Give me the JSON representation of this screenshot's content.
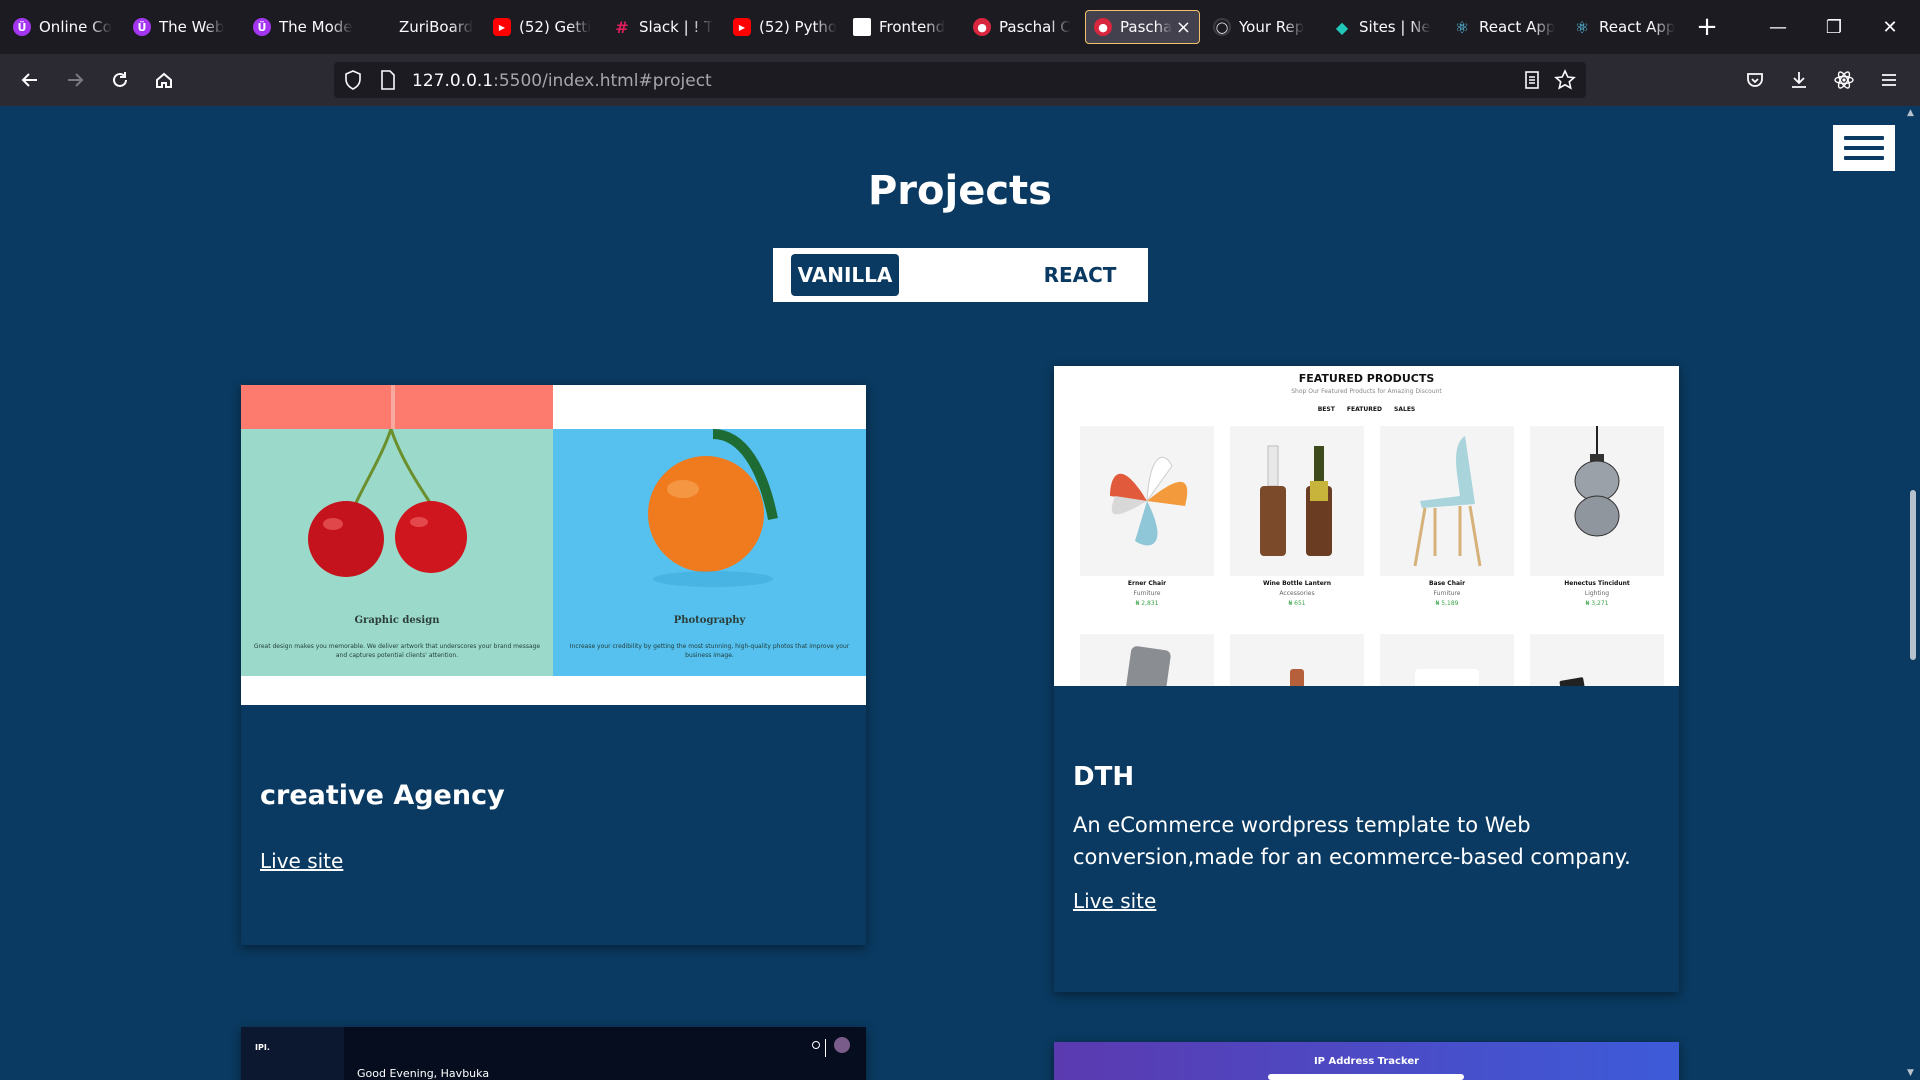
{
  "browser": {
    "tabs": [
      {
        "title": "Online Co",
        "icon": "udemy-icon",
        "color": "#a435f0"
      },
      {
        "title": "The Web",
        "icon": "udemy-icon",
        "color": "#a435f0"
      },
      {
        "title": "The Mode",
        "icon": "udemy-icon",
        "color": "#a435f0"
      },
      {
        "title": "ZuriBoard",
        "icon": "",
        "color": ""
      },
      {
        "title": "(52) Getti",
        "icon": "youtube-icon",
        "color": "#ff0000"
      },
      {
        "title": "Slack | ! T",
        "icon": "slack-icon",
        "color": "#e01e5a"
      },
      {
        "title": "(52) Pytho",
        "icon": "youtube-icon",
        "color": "#ff0000"
      },
      {
        "title": "Frontend",
        "icon": "page-icon",
        "color": "#ffffff"
      },
      {
        "title": "Paschal C",
        "icon": "site-icon",
        "color": "#d7263d"
      },
      {
        "title": "Paschal",
        "icon": "site-icon",
        "color": "#d7263d",
        "active": true
      },
      {
        "title": "Your Rep",
        "icon": "github-icon",
        "color": "#2b2a33"
      },
      {
        "title": "Sites | Ne",
        "icon": "netlify-icon",
        "color": "#20c6b7"
      },
      {
        "title": "React App",
        "icon": "react-icon",
        "color": "#61dafb"
      },
      {
        "title": "React App",
        "icon": "react-icon",
        "color": "#61dafb"
      }
    ],
    "url_host": "127.0.0.1",
    "url_rest": ":5500/index.html#project"
  },
  "page": {
    "heading": "Projects",
    "toggle": {
      "active": "VANILLA",
      "inactive": "REACT"
    },
    "projects": [
      {
        "title": "creative Agency",
        "description": "",
        "link": "Live site",
        "preview": {
          "left_caption": "Graphic design",
          "left_text": "Great design makes you memorable. We deliver artwork that underscores your brand message and captures potential clients' attention.",
          "right_caption": "Photography",
          "right_text": "Increase your credibility by getting the most stunning, high-quality photos that improve your business image."
        }
      },
      {
        "title": "DTH",
        "description": "An eCommerce wordpress template to Web conversion,made for an ecommerce-based company.",
        "link": "Live site",
        "preview": {
          "title": "FEATURED PRODUCTS",
          "subtitle": "Shop Our Featured Products for Amazing Discount",
          "tabs": "BEST FEATURED SALES",
          "products": [
            {
              "name": "Erner Chair",
              "category": "Furniture",
              "price": "₦ 2,831"
            },
            {
              "name": "Wine Bottle Lantern",
              "category": "Accessories",
              "price": "₦ 651"
            },
            {
              "name": "Base Chair",
              "category": "Furniture",
              "price": "₦ 5,189"
            },
            {
              "name": "Henectus Tincidunt",
              "category": "Lighting",
              "price": "₦ 3,271"
            }
          ]
        }
      }
    ],
    "next_previews": {
      "dashboard_logo": "IPI.",
      "dashboard_greeting": "Good Evening, Havbuka",
      "ip_tracker_title": "IP Address Tracker"
    }
  },
  "colors": {
    "page_bg": "#0a3a61",
    "card_bg": "#0a3a61",
    "accent": "#ffffff"
  }
}
